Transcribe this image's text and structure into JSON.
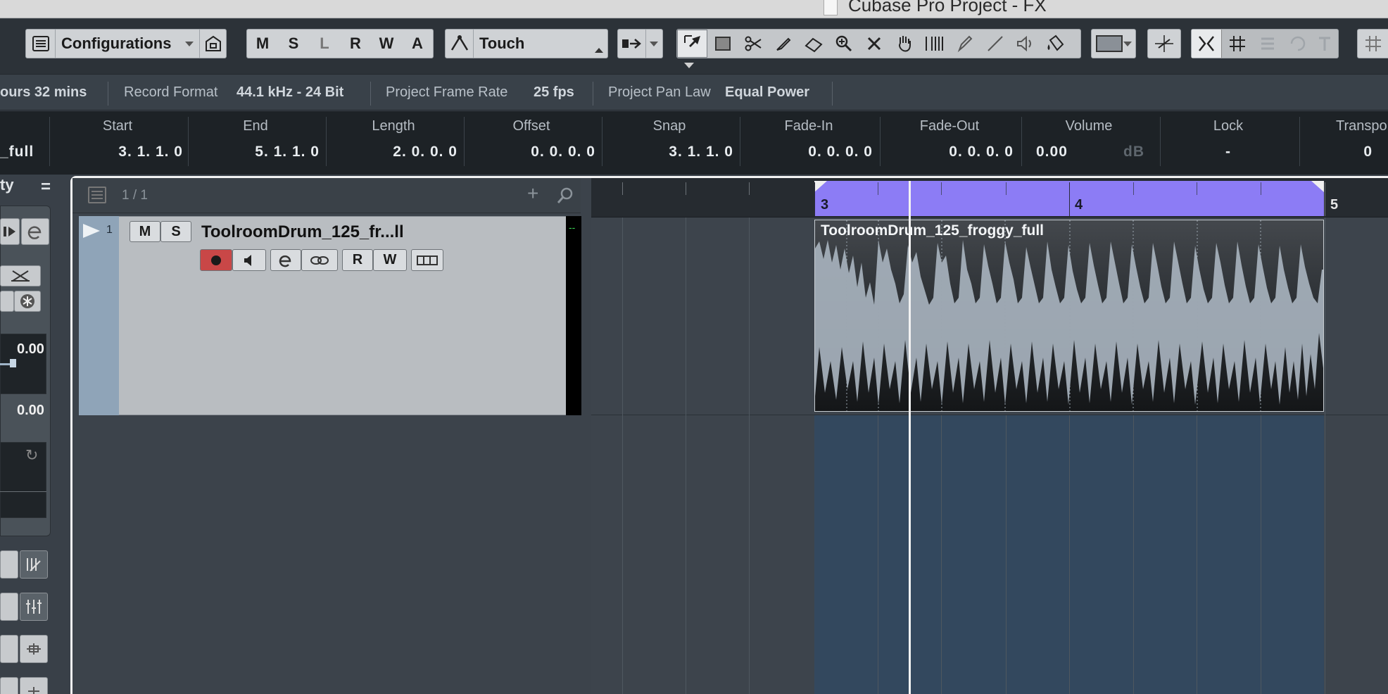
{
  "window": {
    "title": "Cubase Pro Project - FX"
  },
  "toolbar": {
    "configurations_label": "Configurations",
    "automation_buttons": [
      "M",
      "S",
      "L",
      "R",
      "W",
      "A"
    ],
    "automation_mode": "Touch",
    "tools": [
      "object-selection-icon",
      "range-selection-icon",
      "split-icon",
      "glue-icon",
      "erase-icon",
      "zoom-icon",
      "mute-icon",
      "time-warp-icon",
      "comp-icon",
      "draw-icon",
      "line-icon",
      "play-icon",
      "color-icon"
    ]
  },
  "status": {
    "record_time": "ours 32 mins",
    "record_format_label": "Record Format",
    "record_format_value": "44.1 kHz - 24 Bit",
    "frame_rate_label": "Project Frame Rate",
    "frame_rate_value": "25 fps",
    "pan_law_label": "Project Pan Law",
    "pan_law_value": "Equal Power"
  },
  "infoline": {
    "name_value": "_full",
    "fields": [
      {
        "label": "Start",
        "value": "3.  1.  1.   0"
      },
      {
        "label": "End",
        "value": "5.  1.  1.   0"
      },
      {
        "label": "Length",
        "value": "2.  0.  0.   0"
      },
      {
        "label": "Offset",
        "value": "0.  0.  0.   0"
      },
      {
        "label": "Snap",
        "value": "3.  1.  1.   0"
      },
      {
        "label": "Fade-In",
        "value": "0.  0.  0.   0"
      },
      {
        "label": "Fade-Out",
        "value": "0.  0.  0.   0"
      },
      {
        "label": "Volume",
        "value": "0.00",
        "unit": "dB"
      },
      {
        "label": "Lock",
        "value": "-"
      },
      {
        "label": "Transpo",
        "value": "0"
      }
    ]
  },
  "inspector": {
    "header": "ty",
    "volume_value": "0.00",
    "pan_value": "0.00"
  },
  "tracklist": {
    "count": "1 / 1",
    "track": {
      "number": "1",
      "name": "ToolroomDrum_125_fr...ll",
      "mute": "M",
      "solo": "S",
      "read": "R",
      "write": "W",
      "meter_text": "--"
    }
  },
  "ruler": {
    "bars": [
      "3",
      "4",
      "5"
    ]
  },
  "event": {
    "name": "ToolroomDrum_125_froggy_full"
  },
  "colors": {
    "cycle": "#8c7cf5",
    "record": "#d84a4a",
    "event_bg": "#2c3034"
  }
}
